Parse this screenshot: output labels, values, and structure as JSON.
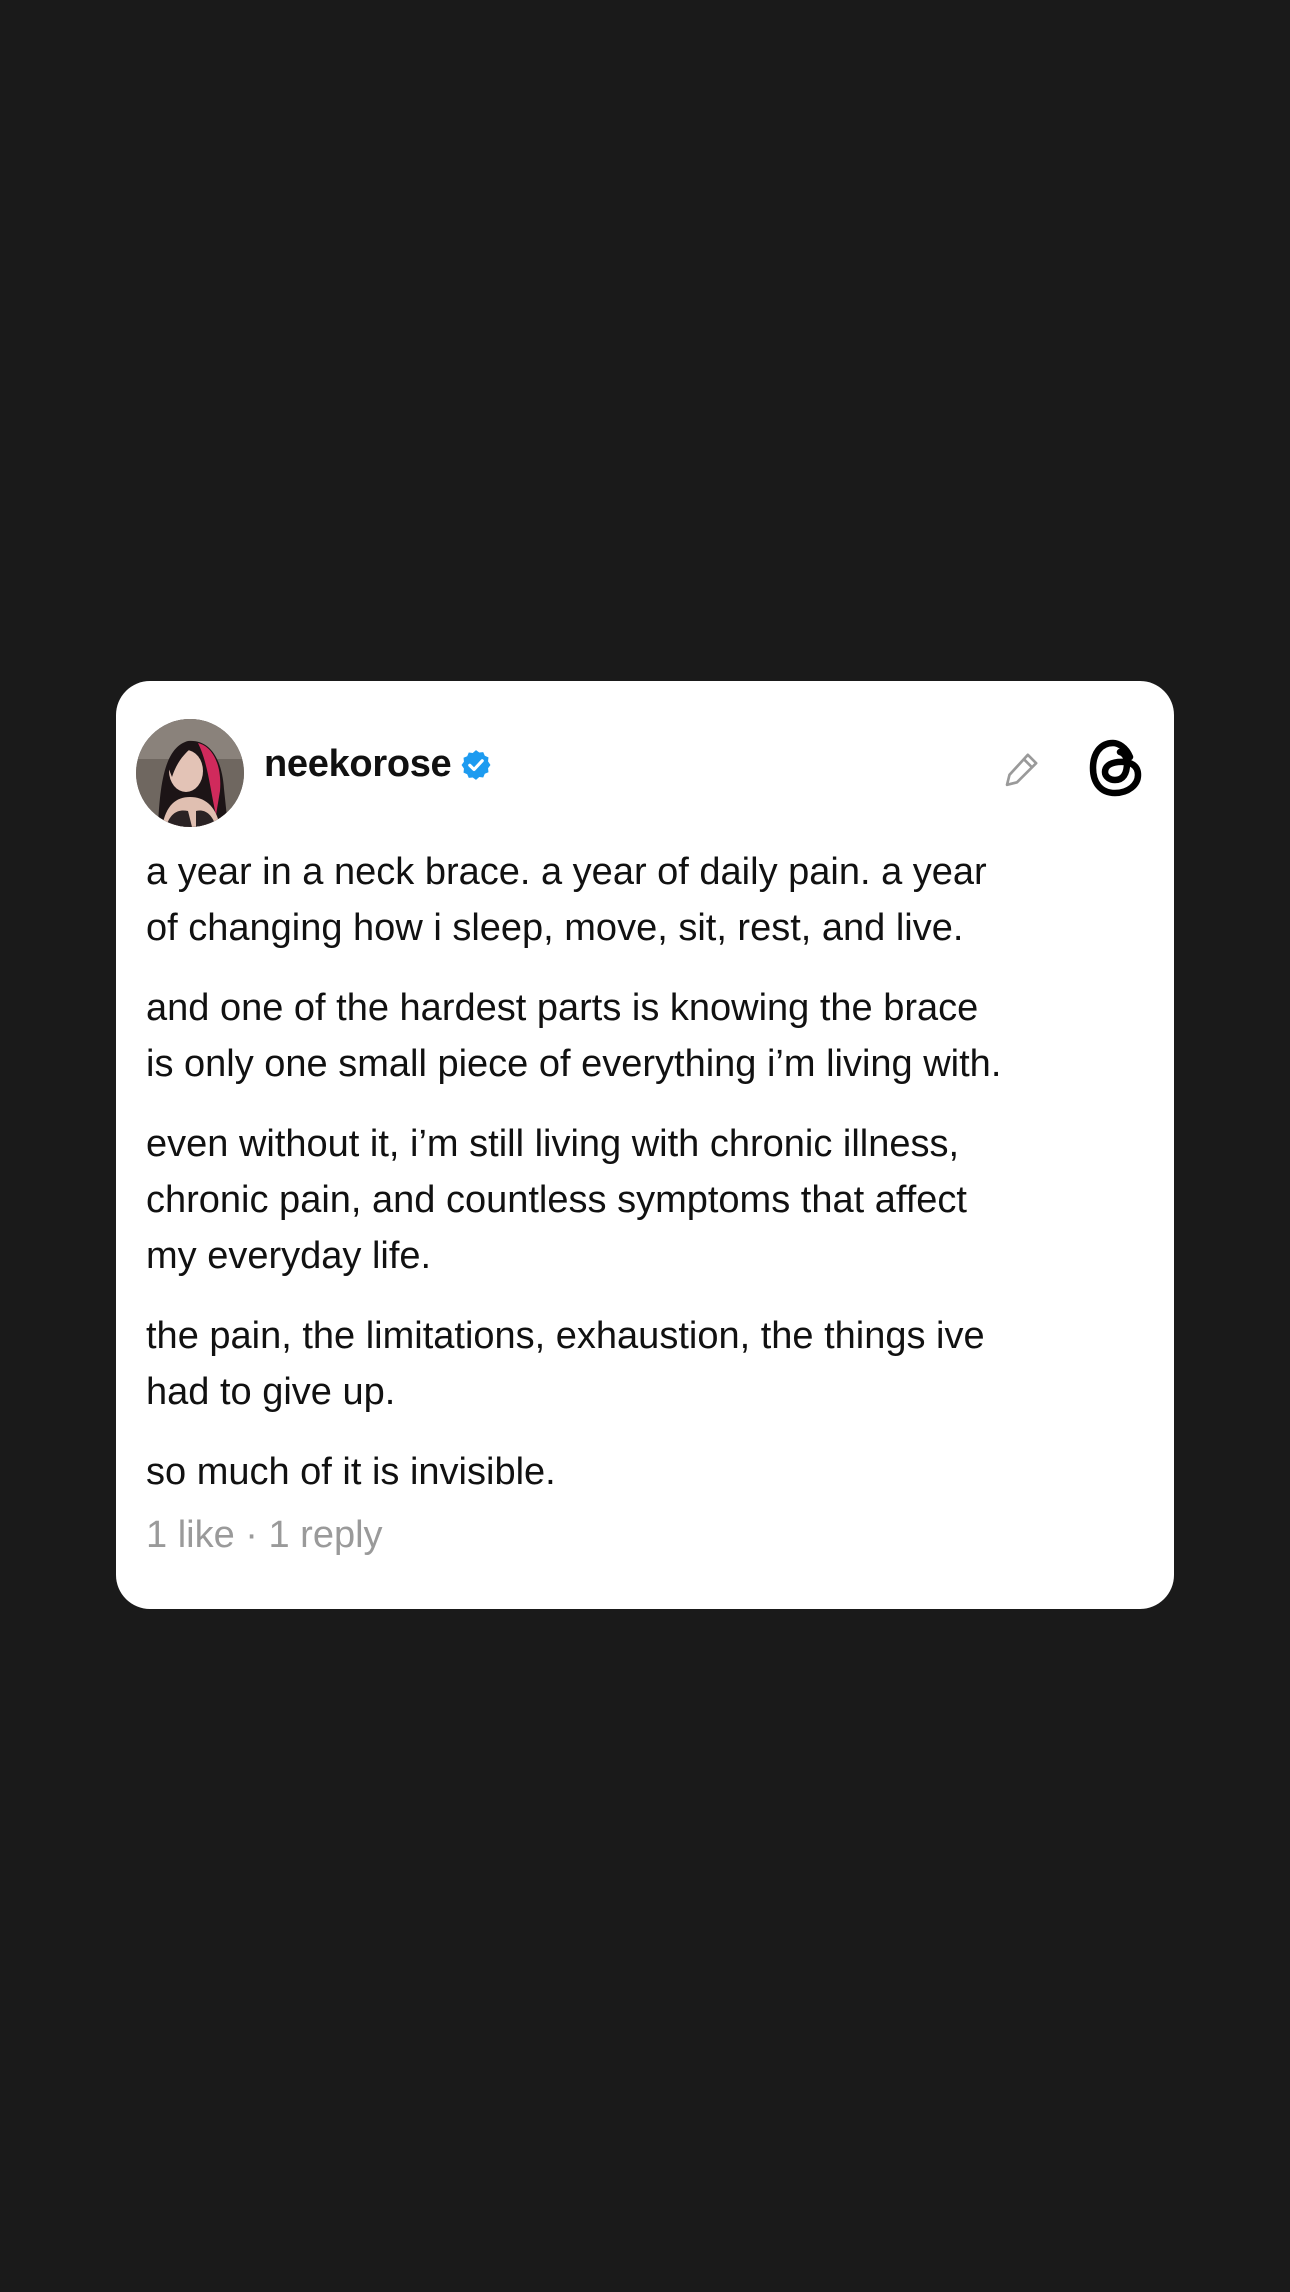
{
  "post": {
    "username": "neekorose",
    "verified": true,
    "paragraphs": [
      "a year in a neck brace. a year of daily pain. a year\nof changing how i sleep, move, sit, rest, and live.",
      "and one of the hardest parts is knowing the brace\nis only one small piece of everything i’m living with.",
      "even without it, i’m still living with chronic illness,\nchronic pain, and countless symptoms that affect\nmy everyday life.",
      "the pain, the limitations, exhaustion, the things ive\nhad to give up.",
      "so much of it is invisible."
    ],
    "stats": "1 like · 1 reply"
  },
  "icons": {
    "verified": "verified-badge-icon",
    "edit": "pencil-icon",
    "brand": "threads-logo-icon"
  },
  "colors": {
    "background": "#1a1a1a",
    "card": "#ffffff",
    "text": "#111111",
    "muted": "#9a9a9a",
    "verified": "#1d9bf0"
  }
}
